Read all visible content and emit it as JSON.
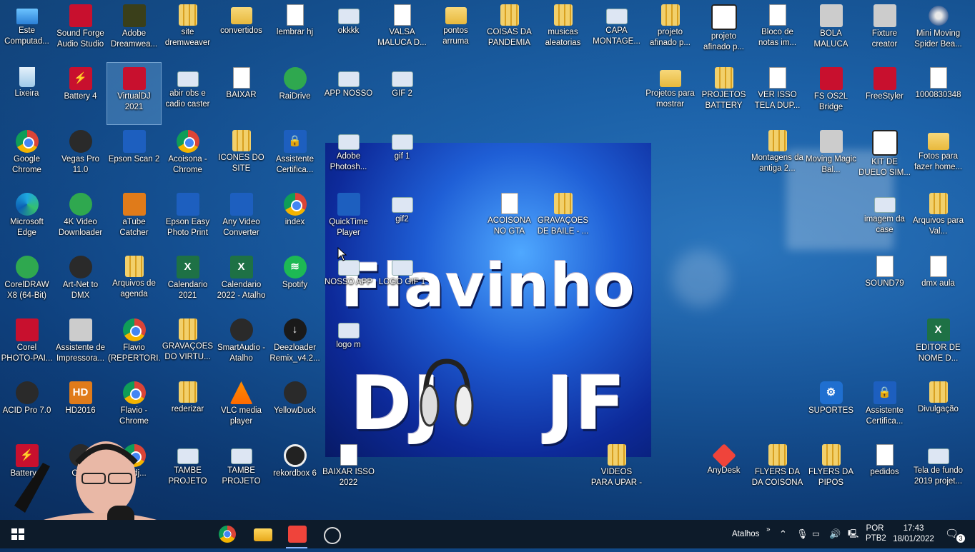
{
  "desktop": {
    "icons": [
      {
        "label": "Este Computad...",
        "icon": "computer-icon"
      },
      {
        "label": "Sound Forge Audio Studio",
        "icon": "sound-forge-icon"
      },
      {
        "label": "Adobe Dreamwea...",
        "icon": "dreamweaver-icon"
      },
      {
        "label": "site dremweaver",
        "icon": "zip-folder-icon"
      },
      {
        "label": "convertidos",
        "icon": "folder-icon"
      },
      {
        "label": "lembrar hj",
        "icon": "document-icon"
      },
      {
        "label": "okkkk",
        "icon": "image-file-icon"
      },
      {
        "label": "VALSA MALUCA D...",
        "icon": "document-icon"
      },
      {
        "label": "pontos arruma",
        "icon": "folder-icon"
      },
      {
        "label": "COISAS DA PANDEMIA",
        "icon": "zip-folder-icon"
      },
      {
        "label": "musicas aleatorias",
        "icon": "zip-folder-icon"
      },
      {
        "label": "CAPA MONTAGE...",
        "icon": "image-file-icon"
      },
      {
        "label": "projeto afinado p...",
        "icon": "zip-folder-icon"
      },
      {
        "label": "projeto afinado p...",
        "icon": "kt-project-icon"
      },
      {
        "label": "Bloco de notas im...",
        "icon": "document-icon"
      },
      {
        "label": "BOLA MALUCA",
        "icon": "moving-head-icon"
      },
      {
        "label": "Fixture creator",
        "icon": "moving-head-icon"
      },
      {
        "label": "Mini Moving Spider Bea...",
        "icon": "spider-light-icon"
      },
      {
        "label": "Lixeira",
        "icon": "recycle-bin-icon"
      },
      {
        "label": "Battery 4",
        "icon": "battery-icon"
      },
      {
        "label": "VirtualDJ 2021",
        "icon": "virtualdj-icon"
      },
      {
        "label": "abir obs e cadio caster",
        "icon": "image-file-icon"
      },
      {
        "label": "BAIXAR",
        "icon": "document-icon"
      },
      {
        "label": "RaiDrive",
        "icon": "raidrive-icon"
      },
      {
        "label": "APP NOSSO",
        "icon": "image-file-icon"
      },
      {
        "label": "GIF 2",
        "icon": "image-file-icon"
      },
      {
        "label": "Projetos para mostrar",
        "icon": "folder-icon"
      },
      {
        "label": "PROJETOS BATTERY",
        "icon": "zip-folder-icon"
      },
      {
        "label": "VER ISSO TELA DUP...",
        "icon": "document-icon"
      },
      {
        "label": "FS OS2L Bridge",
        "icon": "bridge-icon"
      },
      {
        "label": "FreeStyler",
        "icon": "freestyler-icon"
      },
      {
        "label": "1000830348",
        "icon": "certificate-icon"
      },
      {
        "label": "Google Chrome",
        "icon": "chrome-icon"
      },
      {
        "label": "Vegas Pro 11.0",
        "icon": "vegas-icon"
      },
      {
        "label": "Epson Scan 2",
        "icon": "scanner-icon"
      },
      {
        "label": "Acoisona - Chrome",
        "icon": "chrome-icon"
      },
      {
        "label": "ICONES DO SITE",
        "icon": "zip-folder-icon"
      },
      {
        "label": "Assistente Certifica...",
        "icon": "lock-icon"
      },
      {
        "label": "Adobe Photosh...",
        "icon": "image-file-icon"
      },
      {
        "label": "gif 1",
        "icon": "image-file-icon"
      },
      {
        "label": "Montagens da antiga 2...",
        "icon": "zip-folder-icon"
      },
      {
        "label": "Moving Magic Bal...",
        "icon": "moving-head-icon"
      },
      {
        "label": "KIT DE DUELO SIM...",
        "icon": "kt-project-icon"
      },
      {
        "label": "Fotos para fazer home...",
        "icon": "folder-icon"
      },
      {
        "label": "Microsoft Edge",
        "icon": "edge-icon"
      },
      {
        "label": "4K Video Downloader",
        "icon": "download-icon"
      },
      {
        "label": "aTube Catcher",
        "icon": "catcher-icon"
      },
      {
        "label": "Epson Easy Photo Print",
        "icon": "photo-print-icon"
      },
      {
        "label": "Any Video Converter",
        "icon": "converter-icon"
      },
      {
        "label": "index",
        "icon": "chrome-icon"
      },
      {
        "label": "QuickTime Player",
        "icon": "quicktime-icon"
      },
      {
        "label": "gif2",
        "icon": "image-file-icon"
      },
      {
        "label": "ACOISONA NO GTA",
        "icon": "document-icon"
      },
      {
        "label": "GRAVAÇOES DE BAILE - ...",
        "icon": "zip-folder-icon"
      },
      {
        "label": "imagem da case",
        "icon": "image-file-icon"
      },
      {
        "label": "Arquivos para Val...",
        "icon": "zip-folder-icon"
      },
      {
        "label": "CorelDRAW X8 (64-Bit)",
        "icon": "coreldraw-icon"
      },
      {
        "label": "Art-Net to DMX",
        "icon": "artnet-icon"
      },
      {
        "label": "Arquivos de agenda",
        "icon": "zip-folder-icon"
      },
      {
        "label": "Calendario 2021",
        "icon": "excel-icon"
      },
      {
        "label": "Calendario 2022 - Atalho",
        "icon": "excel-icon"
      },
      {
        "label": "Spotify",
        "icon": "spotify-icon"
      },
      {
        "label": "NOSSO APP",
        "icon": "image-file-icon"
      },
      {
        "label": "LOGO GIF 1",
        "icon": "image-file-icon"
      },
      {
        "label": "SOUND79",
        "icon": "media-file-icon"
      },
      {
        "label": "dmx aula",
        "icon": "document-icon"
      },
      {
        "label": "Corel PHOTO-PAI...",
        "icon": "corel-photo-icon"
      },
      {
        "label": "Assistente de Impressora...",
        "icon": "printer-icon"
      },
      {
        "label": "Flavio (REPERTORI...",
        "icon": "chrome-icon"
      },
      {
        "label": "GRAVAÇOES DO VIRTU...",
        "icon": "zip-folder-icon"
      },
      {
        "label": "SmartAudio - Atalho",
        "icon": "headphones-icon"
      },
      {
        "label": "Deezloader Remix_v4.2...",
        "icon": "deezloader-icon"
      },
      {
        "label": "logo m",
        "icon": "image-file-icon"
      },
      {
        "label": "EDITOR DE NOME D...",
        "icon": "excel-icon"
      },
      {
        "label": "ACID Pro 7.0",
        "icon": "acid-icon"
      },
      {
        "label": "HD2016",
        "icon": "hd-icon"
      },
      {
        "label": "Flavio - Chrome",
        "icon": "chrome-icon"
      },
      {
        "label": "rederizar",
        "icon": "zip-folder-icon"
      },
      {
        "label": "VLC media player",
        "icon": "vlc-icon"
      },
      {
        "label": "YellowDuck",
        "icon": "yellowduck-icon"
      },
      {
        "label": "SUPORTES",
        "icon": "settings-icon"
      },
      {
        "label": "Assistente Certifica...",
        "icon": "lock-icon"
      },
      {
        "label": "Divulgação",
        "icon": "zip-folder-icon"
      },
      {
        "label": "Battery 3",
        "icon": "battery-icon"
      },
      {
        "label": "OBS",
        "icon": "obs-icon"
      },
      {
        "label": "...odj...",
        "icon": "chrome-icon"
      },
      {
        "label": "TAMBE PROJETO",
        "icon": "image-file-icon"
      },
      {
        "label": "TAMBE PROJETO",
        "icon": "image-file-icon"
      },
      {
        "label": "rekordbox 6",
        "icon": "rekordbox-icon"
      },
      {
        "label": "BAIXAR ISSO 2022",
        "icon": "document-icon"
      },
      {
        "label": "VIDEOS PARA UPAR - Atal...",
        "icon": "zip-folder-icon"
      },
      {
        "label": "AnyDesk",
        "icon": "anydesk-icon"
      },
      {
        "label": "FLYERS DA DA COISONA",
        "icon": "zip-folder-icon"
      },
      {
        "label": "FLYERS DA PIPOS",
        "icon": "zip-folder-icon"
      },
      {
        "label": "pedidos",
        "icon": "document-icon"
      },
      {
        "label": "Tela de fundo 2019 projet...",
        "icon": "image-file-icon"
      }
    ]
  },
  "flyer": {
    "line1": "Flavinho",
    "line2": "DJ JF"
  },
  "taskbar": {
    "pinned": [
      "start-icon",
      "search-icon",
      "chrome-icon",
      "file-explorer-icon",
      "anydesk-icon",
      "obs-icon"
    ],
    "toolbar_label": "Atalhos",
    "language": "POR",
    "layout": "PTB2",
    "time": "17:43",
    "date": "18/01/2022",
    "notifications": "3"
  },
  "colors": {
    "taskbar": "#0d1b2a",
    "desktop": "#1a5fa6"
  }
}
